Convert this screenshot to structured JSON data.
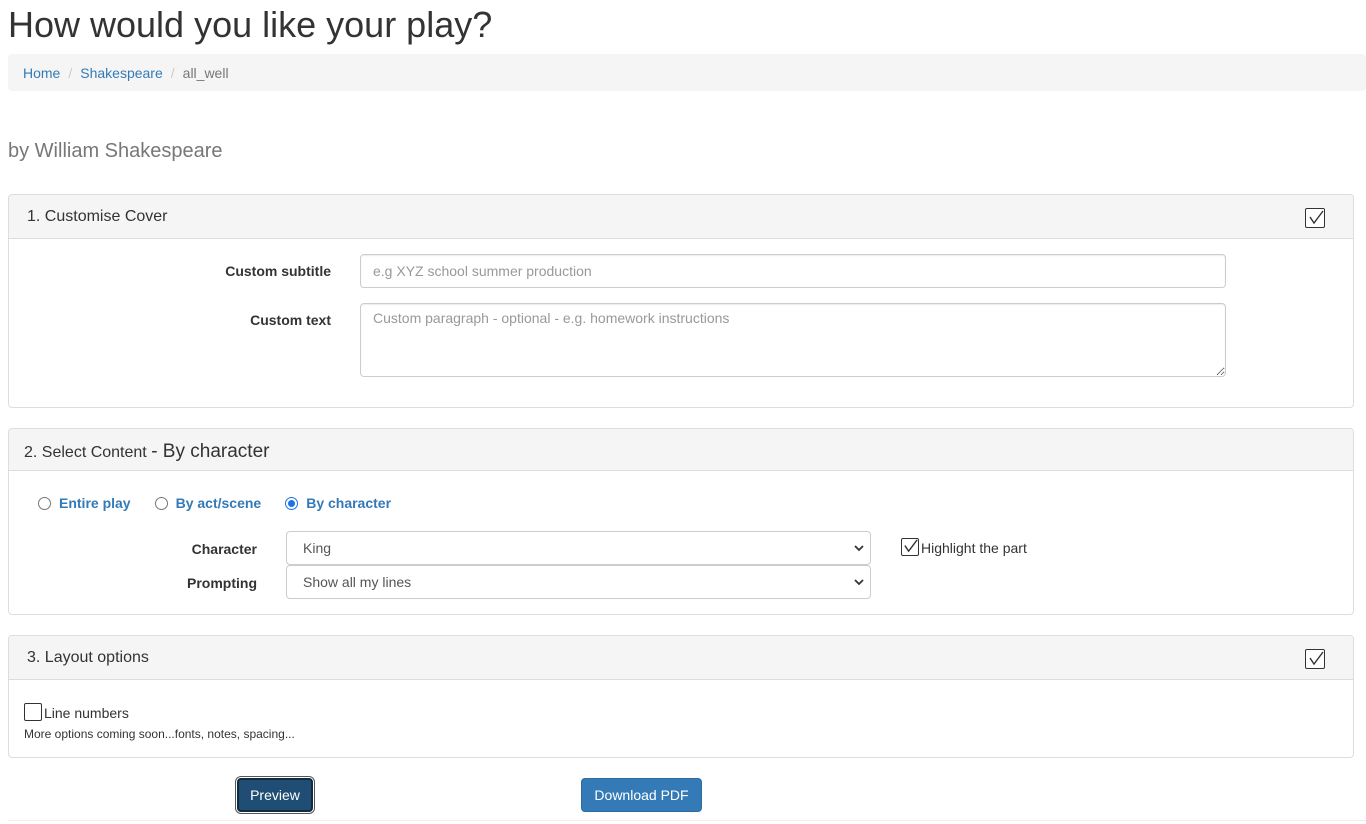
{
  "page": {
    "title": "How would you like your play?",
    "author": "by William Shakespeare"
  },
  "breadcrumb": {
    "home": "Home",
    "shakespeare": "Shakespeare",
    "current": "all_well",
    "separator": "/"
  },
  "cover": {
    "heading": "1. Customise Cover",
    "subtitle_label": "Custom subtitle",
    "subtitle_value": "",
    "subtitle_placeholder": "e.g XYZ school summer production",
    "text_label": "Custom text",
    "text_value": "",
    "text_placeholder": "Custom paragraph - optional - e.g. homework instructions",
    "toggle_checked": true
  },
  "content": {
    "heading": "2. Select Content",
    "heading_suffix": "- By character",
    "options": [
      {
        "label": "Entire play",
        "checked": false
      },
      {
        "label": "By act/scene",
        "checked": false
      },
      {
        "label": "By character",
        "checked": true
      }
    ],
    "character_label": "Character",
    "character_value": "King",
    "prompting_label": "Prompting",
    "prompting_value": "Show all my lines",
    "highlight_label": "Highlight the part",
    "highlight_checked": true
  },
  "layout": {
    "heading": "3. Layout options",
    "line_numbers_label": "Line numbers",
    "line_numbers_checked": false,
    "more_options": "More options coming soon...fonts, notes, spacing...",
    "toggle_checked": true
  },
  "actions": {
    "preview": "Preview",
    "download": "Download PDF"
  },
  "colors": {
    "link": "#337ab7",
    "panel_heading_bg": "#f5f5f5",
    "primary_button": "#337ab7",
    "active_button": "#204d74"
  }
}
